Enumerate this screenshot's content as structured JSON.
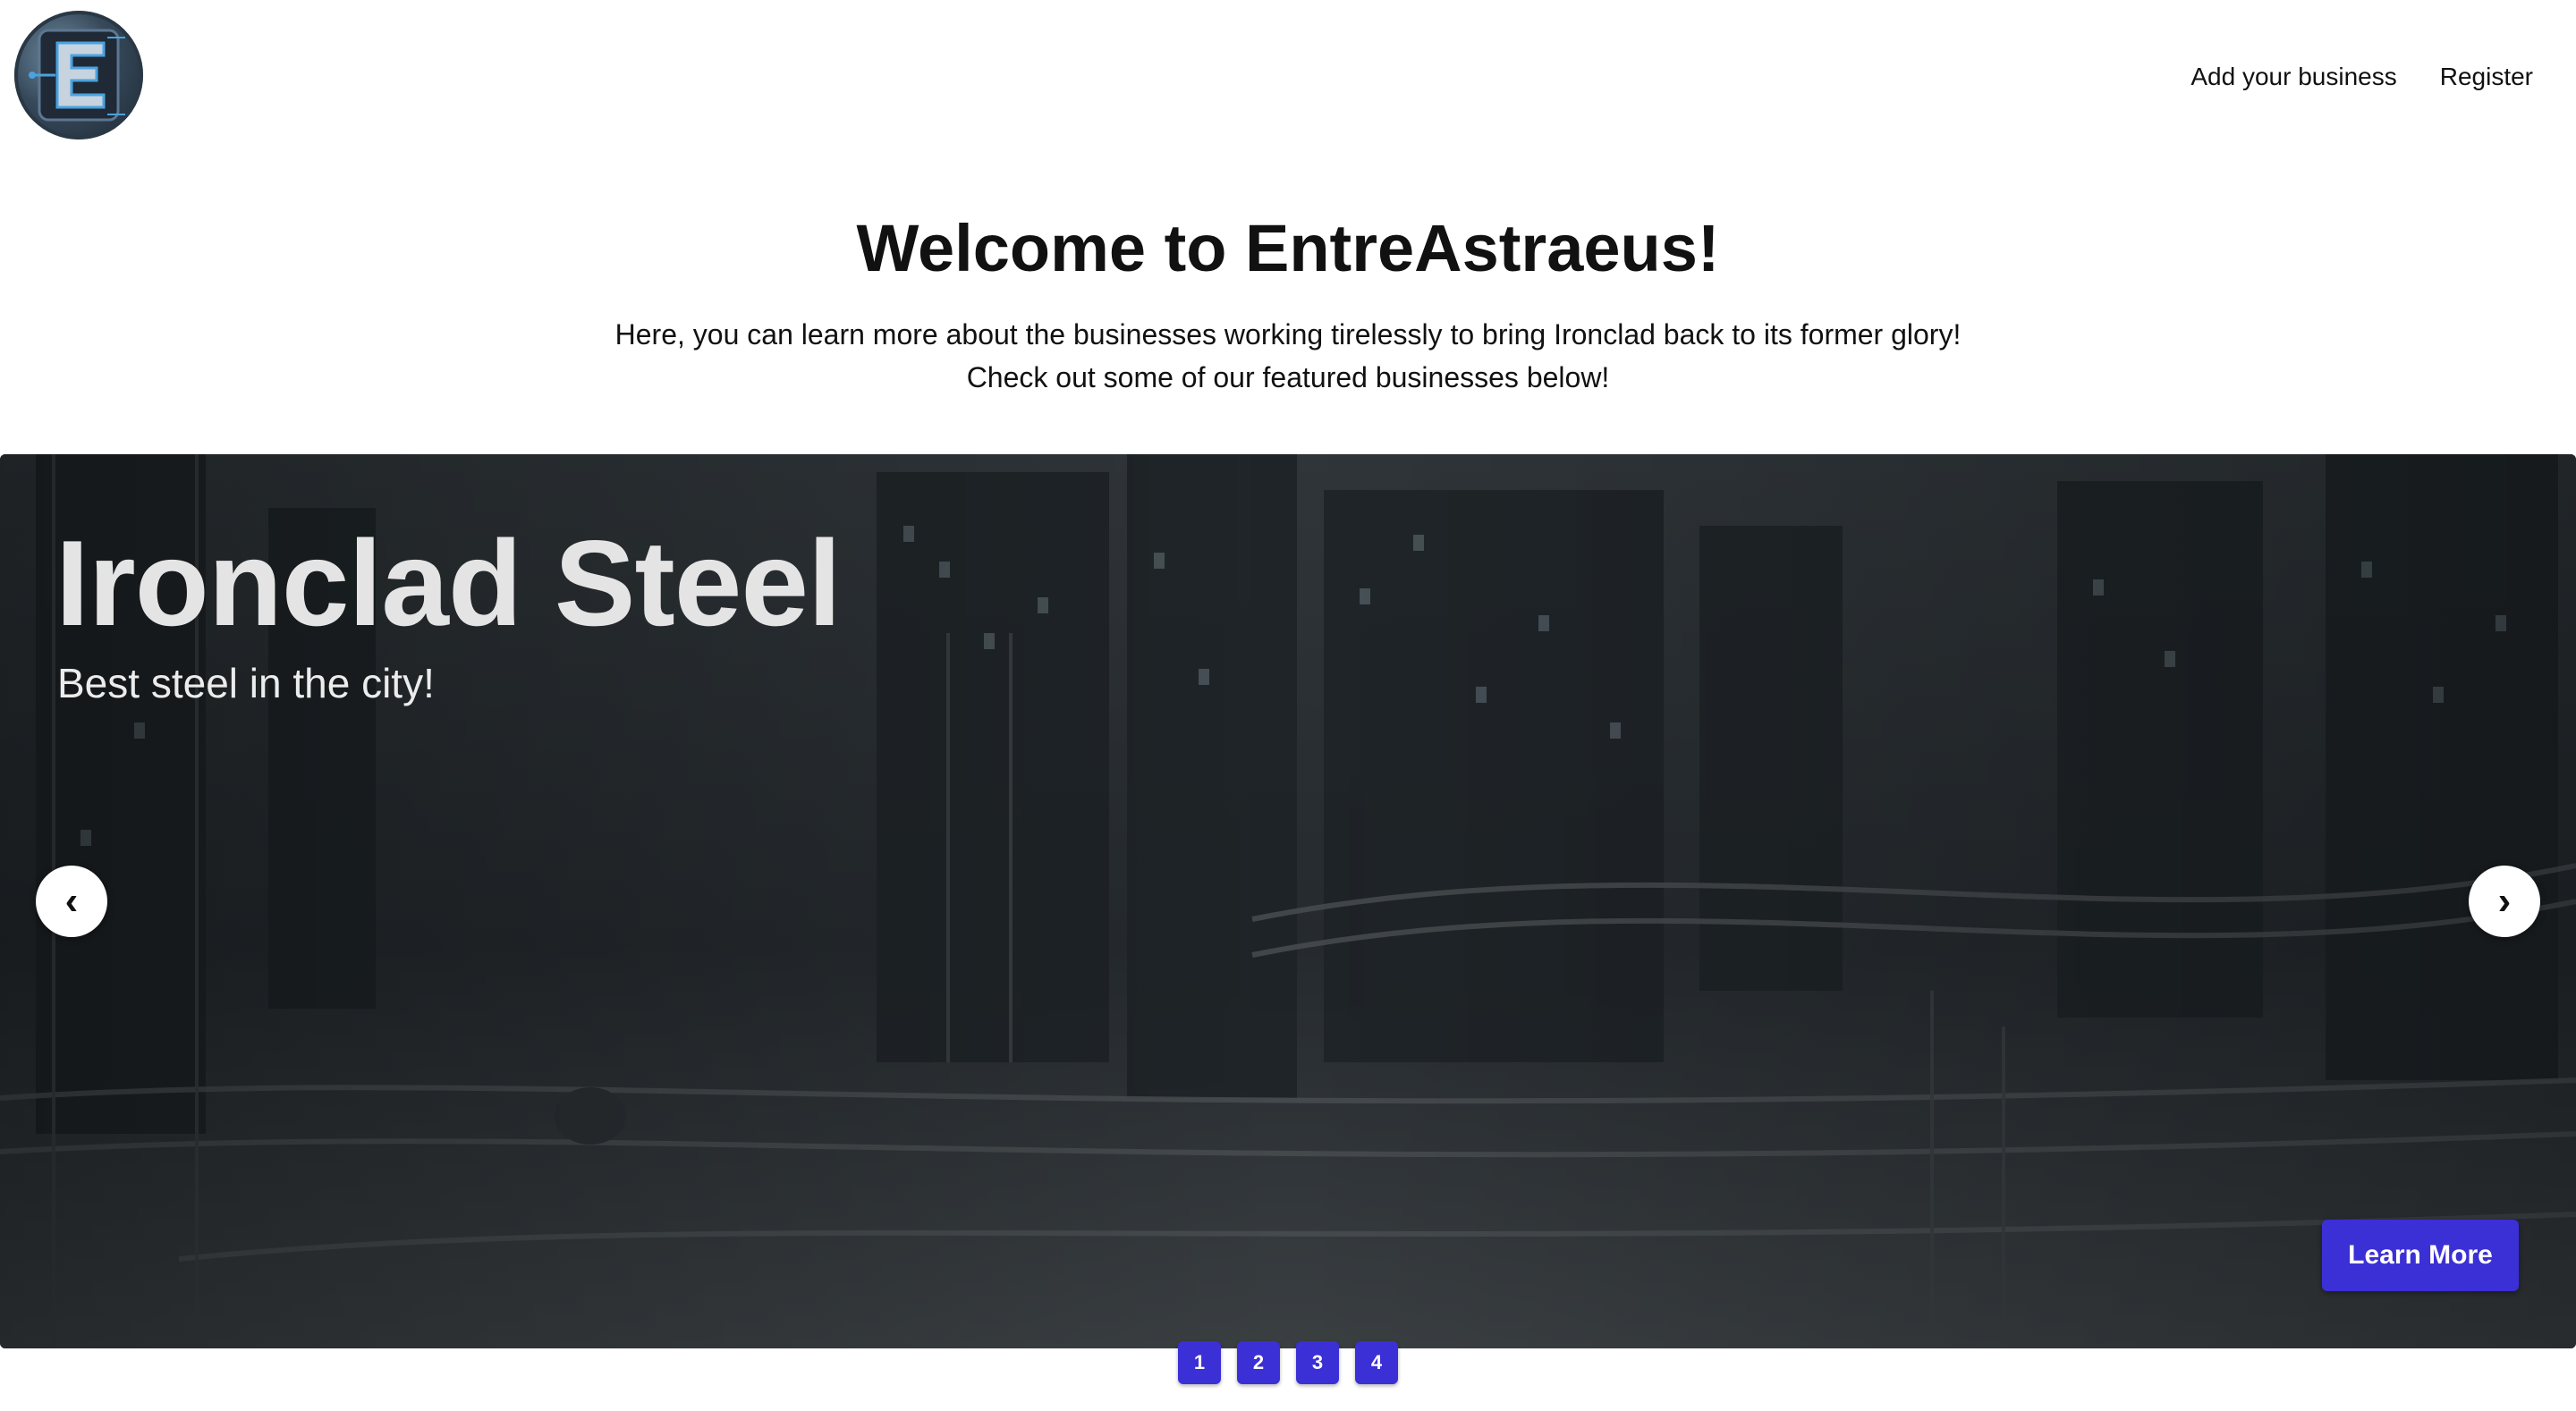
{
  "header": {
    "logo_icon": "entreastraeus-e-logo-icon",
    "nav": {
      "add_business": "Add your business",
      "register": "Register"
    }
  },
  "hero": {
    "title": "Welcome to EntreAstraeus!",
    "intro_line1": "Here, you can learn more about the businesses working tirelessly to bring Ironclad back to its former glory!",
    "intro_line2": "Check out some of our featured businesses below!"
  },
  "carousel": {
    "slide": {
      "title": "Ironclad Steel",
      "subtitle": "Best steel in the city!",
      "cta": "Learn More"
    },
    "prev_label": "‹",
    "next_label": "›",
    "pages": [
      "1",
      "2",
      "3",
      "4"
    ]
  },
  "colors": {
    "accent": "#3b2fd6",
    "text": "#111111",
    "slide_text": "#e4e4e4"
  }
}
